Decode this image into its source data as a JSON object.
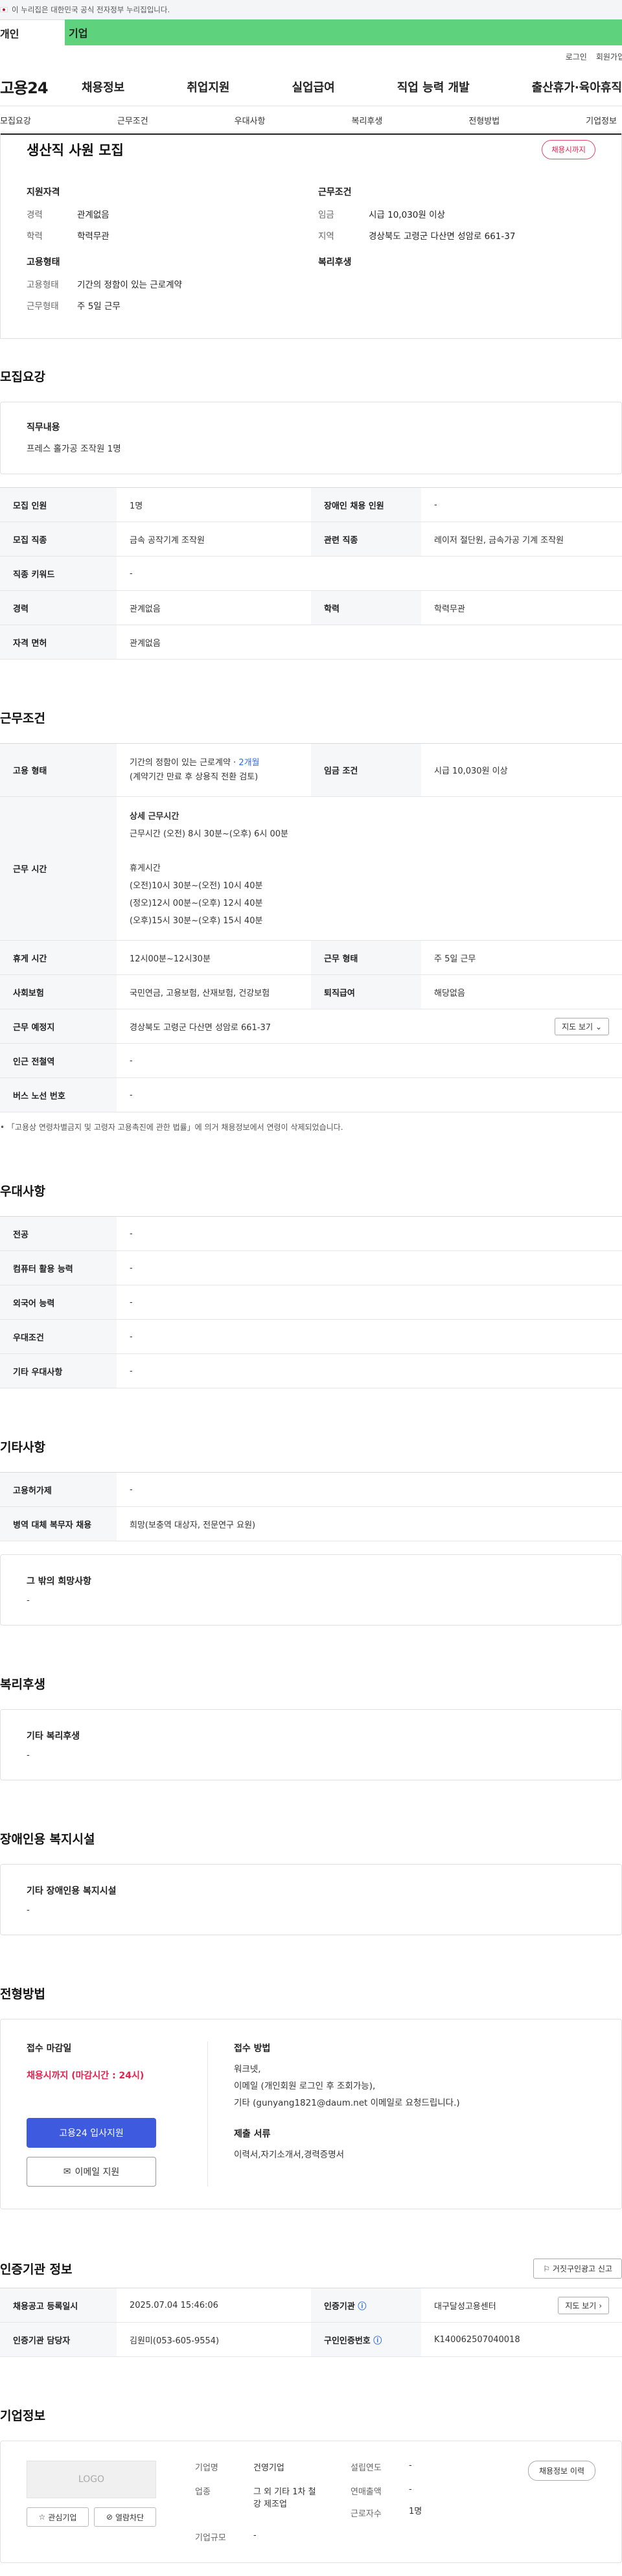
{
  "gov": {
    "notice": "이 누리집은 대한민국 공식 전자정부 누리집입니다."
  },
  "tabs": {
    "person": "개인",
    "company": "기업"
  },
  "util": {
    "login": "로그인",
    "join": "회원가입"
  },
  "gnb": {
    "logo": "고용24",
    "menu": [
      "채용정보",
      "취업지원",
      "실업급여",
      "직업 능력 개발",
      "출산휴가·육아휴직"
    ]
  },
  "anchor": [
    "모집요강",
    "근무조건",
    "우대사항",
    "복리후생",
    "전형방법",
    "기업정보"
  ],
  "summary": {
    "title": "생산직 사원 모집",
    "badge": "채용시까지",
    "qual_title": "지원자격",
    "qual": [
      {
        "k": "경력",
        "v": "관계없음"
      },
      {
        "k": "학력",
        "v": "학력무관"
      }
    ],
    "cond_title": "근무조건",
    "cond": [
      {
        "k": "임금",
        "v": "시급 10,030원 이상"
      },
      {
        "k": "지역",
        "v": "경상북도 고령군 다산면 성암로 661-37"
      }
    ],
    "emp_title": "고용형태",
    "emp": [
      {
        "k": "고용형태",
        "v": "기간의 정함이 있는 근로계약"
      },
      {
        "k": "근무형태",
        "v": "주 5일 근무"
      }
    ],
    "welfare_title": "복리후생"
  },
  "recruit": {
    "title": "모집요강",
    "job_desc_label": "직무내용",
    "job_desc": "프레스 홀가공 조작원 1명",
    "rows": {
      "count_k": "모집 인원",
      "count_v": "1명",
      "disabled_k": "장애인 채용 인원",
      "disabled_v": "-",
      "job_k": "모집 직종",
      "job_v": "금속 공작기계 조작원",
      "related_k": "관련 직종",
      "related_v": "레이저 절단원, 금속가공 기계 조작원",
      "keyword_k": "직종 키워드",
      "keyword_v": "-",
      "career_k": "경력",
      "career_v": "관계없음",
      "edu_k": "학력",
      "edu_v": "학력무관",
      "license_k": "자격 면허",
      "license_v": "관계없음"
    }
  },
  "work": {
    "title": "근무조건",
    "emp_k": "고용 형태",
    "emp_v1": "기간의 정함이 있는 근로계약 · ",
    "emp_v1_blue": "2개월",
    "emp_v2": "(계약기간 만료 후 상용직 전환 검토)",
    "wage_k": "임금 조건",
    "wage_v": "시급 10,030원 이상",
    "hours_k": "근무 시간",
    "hours_title": "상세 근무시간",
    "hours_detail": "근무시간 (오전) 8시 30분~(오후) 6시 00분",
    "break_title": "휴게시간",
    "break_lines": [
      "(오전)10시 30분~(오전) 10시 40분",
      "(정오)12시 00분~(오후) 12시 40분",
      "(오후)15시 30분~(오후) 15시 40분"
    ],
    "rest_k": "휴게 시간",
    "rest_v": "12시00분~12시30분",
    "type_k": "근무 형태",
    "type_v": "주 5일 근무",
    "ins_k": "사회보험",
    "ins_v": "국민연금, 고용보험, 산재보험, 건강보험",
    "ret_k": "퇴직급여",
    "ret_v": "해당없음",
    "place_k": "근무 예정지",
    "place_v": "경상북도 고령군 다산면 성암로 661-37",
    "map_btn": "지도 보기",
    "subway_k": "인근 전철역",
    "subway_v": "-",
    "bus_k": "버스 노선 번호",
    "bus_v": "-",
    "note": "「고용상 연령차별금지 및 고령자 고용촉진에 관한 법률」에 의거 채용정보에서 연령이 삭제되었습니다."
  },
  "pref": {
    "title": "우대사항",
    "rows": [
      {
        "k": "전공",
        "v": "-"
      },
      {
        "k": "컴퓨터 활용 능력",
        "v": "-"
      },
      {
        "k": "외국어 능력",
        "v": "-"
      },
      {
        "k": "우대조건",
        "v": "-"
      },
      {
        "k": "기타 우대사항",
        "v": "-"
      }
    ]
  },
  "etc": {
    "title": "기타사항",
    "rows": [
      {
        "k": "고용허가제",
        "v": "-"
      },
      {
        "k": "병역 대체 복무자 채용",
        "v": "희망(보충역 대상자, 전문연구 요원)"
      }
    ],
    "other_label": "그 밖의 희망사항",
    "other_v": "-"
  },
  "welfare": {
    "title": "복리후생",
    "label": "기타 복리후생",
    "v": "-"
  },
  "disab": {
    "title": "장애인용 복지시설",
    "label": "기타 장애인용 복지시설",
    "v": "-"
  },
  "apply": {
    "title": "전형방법",
    "deadline_label": "접수 마감일",
    "deadline": "채용시까지 (마감시간 : 24시)",
    "btn_apply": "고용24 입사지원",
    "btn_email": "이메일 지원",
    "method_label": "접수 방법",
    "method_lines": [
      "워크넷,",
      "이메일 (개인회원 로그인 후 조회가능),",
      "기타 (gunyang1821@daum.net 이메일로 요청드립니다.)"
    ],
    "docs_label": "제출 서류",
    "docs": "이력서,자기소개서,경력증명서"
  },
  "cert": {
    "title": "인증기관 정보",
    "report_btn": "거짓구인광고 신고",
    "reg_k": "채용공고 등록일시",
    "reg_v": "2025.07.04 15:46:06",
    "org_k": "인증기관",
    "org_v": "대구달성고용센터",
    "map_btn": "지도 보기",
    "mgr_k": "인증기관 담당자",
    "mgr_v": "김원미(053-605-9554)",
    "no_k": "구인인증번호",
    "no_v": "K140062507040018"
  },
  "company": {
    "title": "기업정보",
    "logo": "LOGO",
    "interest": "관심기업",
    "block": "열람차단",
    "history_btn": "채용정보 이력",
    "name_k": "기업명",
    "name_v": "건영기업",
    "biz_k": "업종",
    "biz_v1": "그 외 기타 1차 철",
    "biz_v2": "강 제조업",
    "size_k": "기업규모",
    "size_v": "-",
    "year_k": "설립연도",
    "year_v": "-",
    "sales_k": "연매출액",
    "sales_v": "-",
    "emp_k": "근로자수",
    "emp_v": "1명"
  }
}
